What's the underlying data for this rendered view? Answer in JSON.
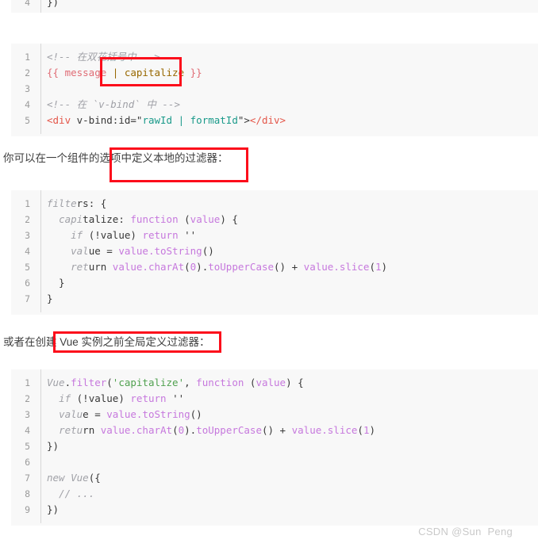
{
  "page": {
    "watermark": "CSDN @Sun  Peng"
  },
  "colors": {
    "annotation_red": "#fc0d1b",
    "code_background": "#f8f8f8",
    "page_background": "#ffffff",
    "line_number": "#9b9b9b"
  },
  "blocks": {
    "top_partial": {
      "name": "code-block-partial-top",
      "lines": [
        {
          "number": "4",
          "text": "})"
        }
      ]
    },
    "template_usage": {
      "name": "code-block-template-usage",
      "lines": [
        {
          "number": "1",
          "text": "<!-- 在双花括号中 -->"
        },
        {
          "number": "2",
          "text": "{{ message | capitalize }}"
        },
        {
          "number": "3",
          "text": ""
        },
        {
          "number": "4",
          "text": "<!-- 在 `v-bind` 中 -->"
        },
        {
          "number": "5",
          "text": "<div v-bind:id=\"rawId | formatId\"></div>"
        }
      ]
    },
    "local_filter": {
      "name": "code-block-local-filter",
      "lines": [
        {
          "number": "1",
          "text": "filters: {"
        },
        {
          "number": "2",
          "text": "  capitalize: function (value) {"
        },
        {
          "number": "3",
          "text": "    if (!value) return ''"
        },
        {
          "number": "4",
          "text": "    value = value.toString()"
        },
        {
          "number": "5",
          "text": "    return value.charAt(0).toUpperCase() + value.slice(1)"
        },
        {
          "number": "6",
          "text": "  }"
        },
        {
          "number": "7",
          "text": "}"
        }
      ]
    },
    "global_filter": {
      "name": "code-block-global-filter",
      "lines": [
        {
          "number": "1",
          "text": "Vue.filter('capitalize', function (value) {"
        },
        {
          "number": "2",
          "text": "  if (!value) return ''"
        },
        {
          "number": "3",
          "text": "  value = value.toString()"
        },
        {
          "number": "4",
          "text": "  return value.charAt(0).toUpperCase() + value.slice(1)"
        },
        {
          "number": "5",
          "text": "})"
        },
        {
          "number": "6",
          "text": ""
        },
        {
          "number": "7",
          "text": "new Vue({"
        },
        {
          "number": "8",
          "text": "  // ..."
        },
        {
          "number": "9",
          "text": "})"
        }
      ]
    }
  },
  "prose": {
    "local_filters": "你可以在一个组件的选项中定义本地的过滤器：",
    "global_filters": "或者在创建 Vue 实例之前全局定义过滤器："
  },
  "annotations": [
    {
      "label": "highlight-capitalize-filter"
    },
    {
      "label": "highlight-local-filters-sentence"
    },
    {
      "label": "highlight-global-filters-sentence"
    }
  ]
}
